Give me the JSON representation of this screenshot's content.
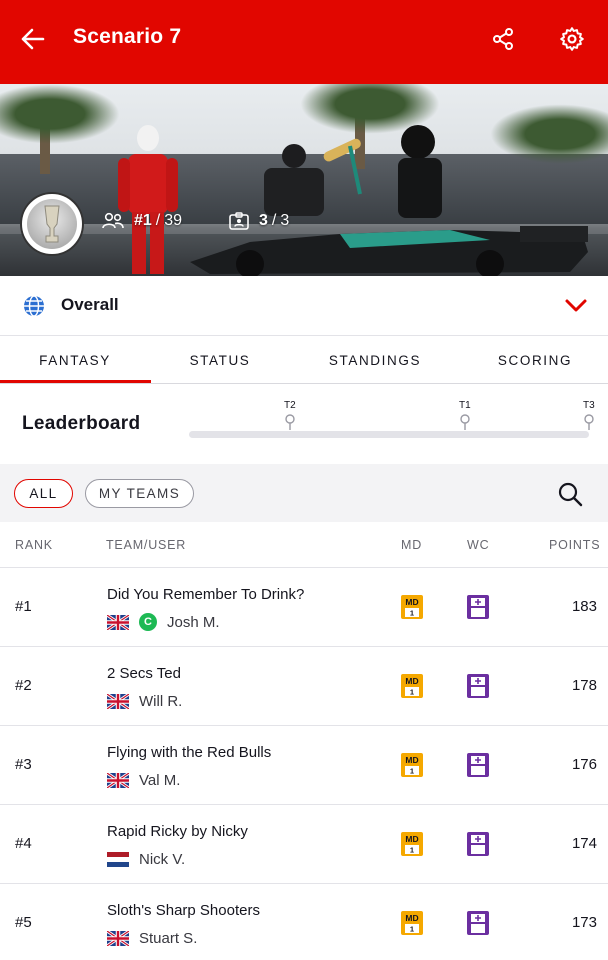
{
  "header": {
    "title": "Scenario 7",
    "back_icon": "arrow-left-icon",
    "share_icon": "share-icon",
    "settings_icon": "gear-icon",
    "bg_color": "#e10600"
  },
  "hero": {
    "rank_label": "#1",
    "rank_total": "39",
    "teams_label": "3",
    "teams_total": "3",
    "rank_icon": "users-icon",
    "teams_icon": "id-card-icon",
    "badge_icon": "trophy-icon"
  },
  "league_selector": {
    "label": "Overall",
    "icon": "globe-icon",
    "chevron": "chevron-down-icon"
  },
  "tabs": [
    {
      "label": "FANTASY",
      "active": true
    },
    {
      "label": "STATUS",
      "active": false
    },
    {
      "label": "STANDINGS",
      "active": false
    },
    {
      "label": "SCORING",
      "active": false
    }
  ],
  "leaderboard": {
    "title": "Leaderboard",
    "markers": [
      "T2",
      "T1",
      "T3"
    ]
  },
  "filters": {
    "all_label": "ALL",
    "my_teams_label": "MY TEAMS",
    "search_icon": "search-icon"
  },
  "table": {
    "headers": {
      "rank": "RANK",
      "team": "TEAM/USER",
      "md": "MD",
      "wc": "WC",
      "points": "POINTS"
    },
    "rows": [
      {
        "rank": "#1",
        "team": "Did You Remember To Drink?",
        "user": "Josh M.",
        "flag": "uk",
        "chip": "C",
        "md": "MD",
        "md_num": "1",
        "points": "183"
      },
      {
        "rank": "#2",
        "team": "2 Secs Ted",
        "user": "Will R.",
        "flag": "uk",
        "md": "MD",
        "md_num": "1",
        "points": "178"
      },
      {
        "rank": "#3",
        "team": "Flying with the Red Bulls",
        "user": "Val M.",
        "flag": "uk",
        "md": "MD",
        "md_num": "1",
        "points": "176"
      },
      {
        "rank": "#4",
        "team": "Rapid Ricky by Nicky",
        "user": "Nick V.",
        "flag": "nl",
        "md": "MD",
        "md_num": "1",
        "points": "174"
      },
      {
        "rank": "#5",
        "team": "Sloth's Sharp Shooters",
        "user": "Stuart S.",
        "flag": "uk",
        "md": "MD",
        "md_num": "1",
        "points": "173"
      }
    ]
  },
  "colors": {
    "accent": "#e10600",
    "md_badge": "#f5a800",
    "wc_badge": "#6b2fa0",
    "chip_green": "#1db954"
  }
}
